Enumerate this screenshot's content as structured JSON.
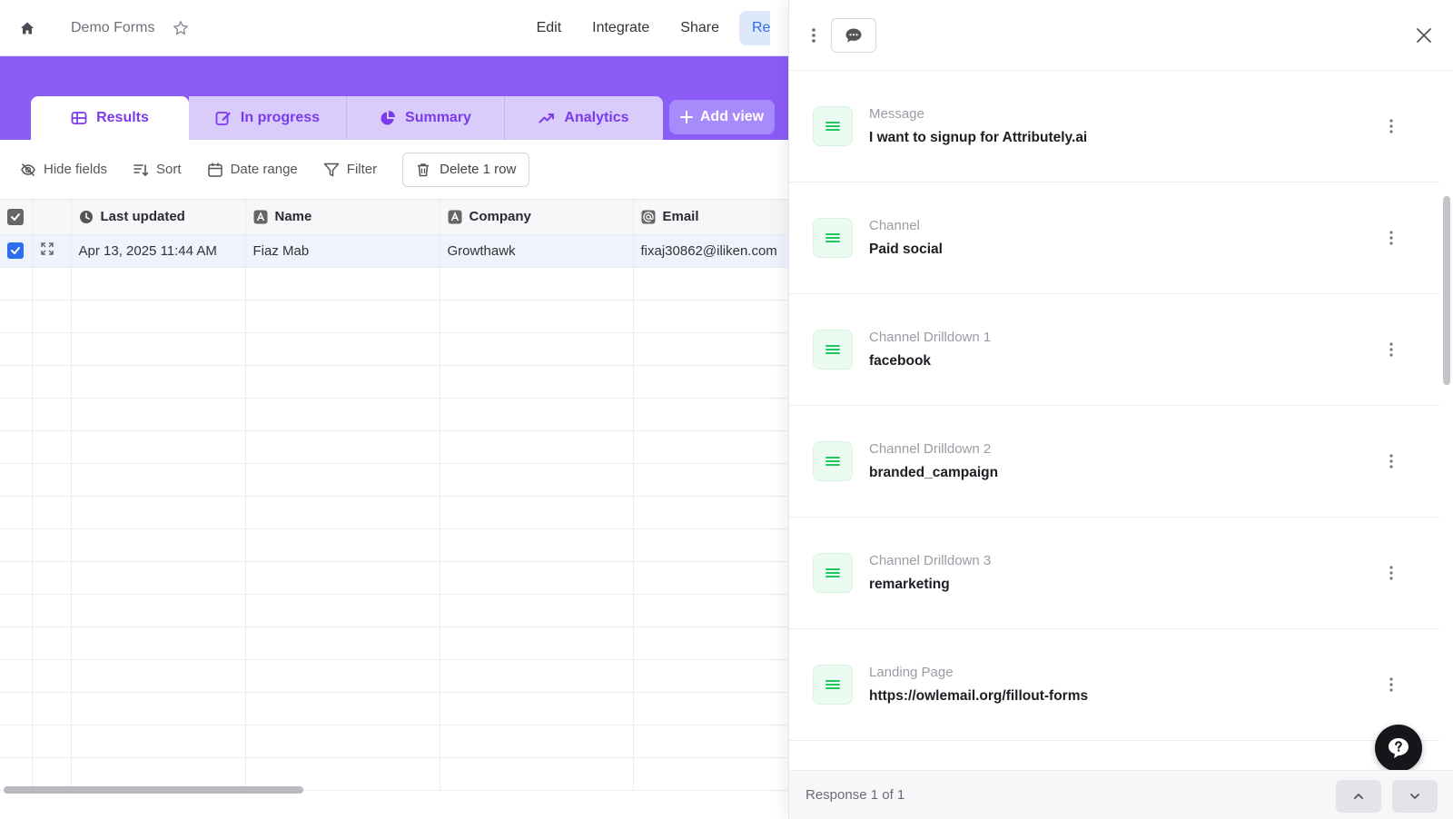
{
  "header": {
    "breadcrumb": "Demo Forms",
    "nav": [
      "Edit",
      "Integrate",
      "Share"
    ],
    "nav_active": "Re"
  },
  "tabs": [
    {
      "label": "Results",
      "icon": "table-icon"
    },
    {
      "label": "In progress",
      "icon": "edit-icon"
    },
    {
      "label": "Summary",
      "icon": "pie-chart-icon"
    },
    {
      "label": "Analytics",
      "icon": "trend-icon"
    }
  ],
  "add_view_label": "Add view",
  "toolbar": {
    "hide_fields": "Hide fields",
    "sort": "Sort",
    "date_range": "Date range",
    "filter": "Filter",
    "delete": "Delete 1 row"
  },
  "table": {
    "columns": [
      "Last updated",
      "Name",
      "Company",
      "Email"
    ],
    "rows": [
      {
        "last_updated": "Apr 13, 2025 11:44 AM",
        "name": "Fiaz Mab",
        "company": "Growthawk",
        "email": "fixaj30862@iliken.com"
      }
    ]
  },
  "panel": {
    "fields": [
      {
        "label": "Message",
        "value": "I want to signup for Attributely.ai"
      },
      {
        "label": "Channel",
        "value": "Paid social"
      },
      {
        "label": "Channel Drilldown 1",
        "value": "facebook"
      },
      {
        "label": "Channel Drilldown 2",
        "value": "branded_campaign"
      },
      {
        "label": "Channel Drilldown 3",
        "value": "remarketing"
      },
      {
        "label": "Landing Page",
        "value": "https://owlemail.org/fillout-forms"
      }
    ],
    "response_counter": "Response 1 of 1"
  },
  "colors": {
    "brand_purple": "#8b5cf6",
    "tab_text": "#7c3aed",
    "checkbox_blue": "#2f6df0",
    "field_icon_green": "#22c55e"
  }
}
